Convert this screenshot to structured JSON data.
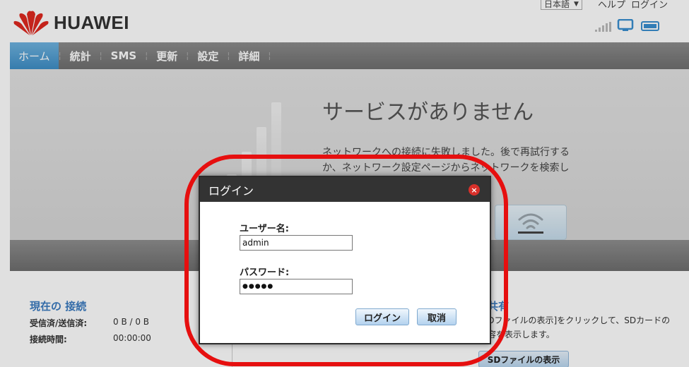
{
  "header": {
    "logo_text": "HUAWEI",
    "language": "日本語",
    "help_label": "ヘルプ",
    "login_label": "ログイン"
  },
  "nav": {
    "items": [
      {
        "label": "ホーム"
      },
      {
        "label": "統計"
      },
      {
        "label": "SMS"
      },
      {
        "label": "更新"
      },
      {
        "label": "設定"
      },
      {
        "label": "詳細"
      }
    ]
  },
  "banner": {
    "title": "サービスがありません",
    "description": "ネットワークへの接続に失敗しました。後で再試行するか、ネットワーク設定ページからネットワークを検索して下さい。"
  },
  "connection": {
    "title": "現在の 接続",
    "rows": [
      {
        "label": "受信済/送信済:",
        "value": "0 B / 0 B"
      },
      {
        "label": "接続時間:",
        "value": "00:00:00"
      }
    ]
  },
  "sd": {
    "title": "共有",
    "description": "[SDファイルの表示]をクリックして、SDカードの内容を表示します。",
    "button_label": "SDファイルの表示"
  },
  "dialog": {
    "title": "ログイン",
    "username_label": "ユーザー名:",
    "username_value": "admin",
    "password_label": "パスワード:",
    "password_value": "●●●●●",
    "login_button": "ログイン",
    "cancel_button": "取消"
  },
  "colors": {
    "accent_blue": "#3c7cc0",
    "annotation_red": "#e60f0f",
    "nav_gray": "#7a7a7a",
    "nav_active": "#4f9bd0"
  }
}
